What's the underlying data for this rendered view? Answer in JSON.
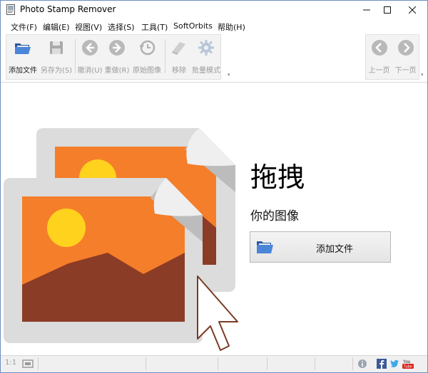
{
  "window": {
    "title": "Photo Stamp Remover"
  },
  "menu": {
    "items": [
      "文件(F)",
      "编辑(E)",
      "视图(V)",
      "选择(S)",
      "工具(T)",
      "SoftOrbits",
      "帮助(H)"
    ]
  },
  "toolbar": {
    "open_label": "添加文件",
    "save_as_label": "另存为(S)",
    "undo_label": "撤消(U)",
    "redo_label": "重做(R)",
    "original_label": "原始图像",
    "remove_label": "移除",
    "batch_label": "批量模式",
    "prev_label": "上一页",
    "next_label": "下一页"
  },
  "main": {
    "drag_title": "拖拽",
    "drag_subtitle": "你的图像",
    "add_file_button": "添加文件"
  },
  "statusbar": {
    "zoom": "1:1"
  },
  "colors": {
    "accent_orange": "#f57e2a",
    "sun_yellow": "#ffd21e",
    "mountain_brown": "#8b3c26",
    "frame_gray": "#dcdcdc",
    "folder_blue": "#3d6fb6"
  }
}
